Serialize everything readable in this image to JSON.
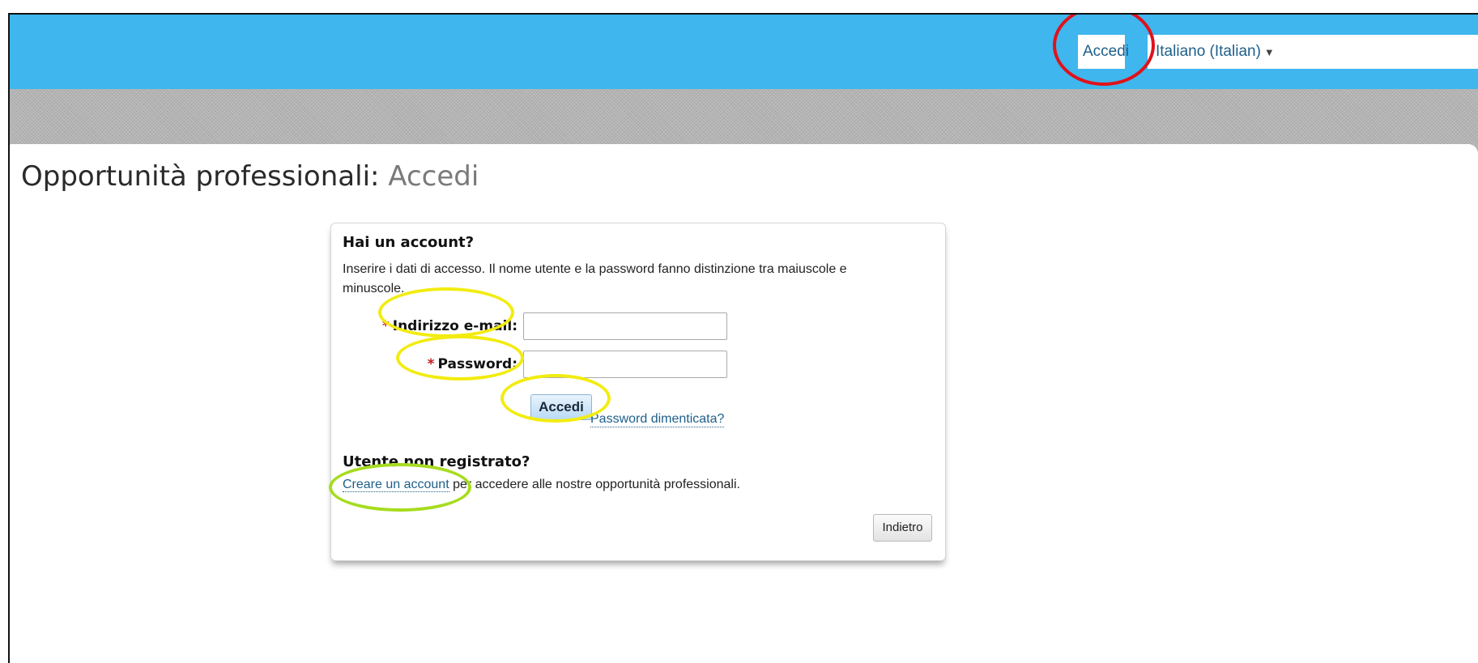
{
  "topbar": {
    "sign_in_label": "Accedi",
    "language_label": "Italiano (Italian)",
    "language_caret_icon": "chevron-down-icon",
    "background_color": "#3fb6ee"
  },
  "page": {
    "title": "Opportunità professionali:",
    "subtitle": "Accedi"
  },
  "login_card": {
    "heading": "Hai un account?",
    "instructions": "Inserire i dati di accesso. Il nome utente e la password fanno distinzione tra maiuscole e minuscole.",
    "required_marker": "*",
    "email_label": "Indirizzo e-mail:",
    "email_value": "",
    "password_label": "Password:",
    "password_value": "",
    "submit_label": "Accedi",
    "forgot_password_link": "Password dimenticata?"
  },
  "register_section": {
    "heading": "Utente non registrato?",
    "create_account_link": "Creare un account",
    "create_account_suffix": " per accedere alle nostre opportunità professionali.",
    "back_button": "Indietro"
  },
  "annotations": {
    "red_color": "#e0121a",
    "yellow_color": "#f2ec10",
    "green_color": "#a6dc1e"
  }
}
